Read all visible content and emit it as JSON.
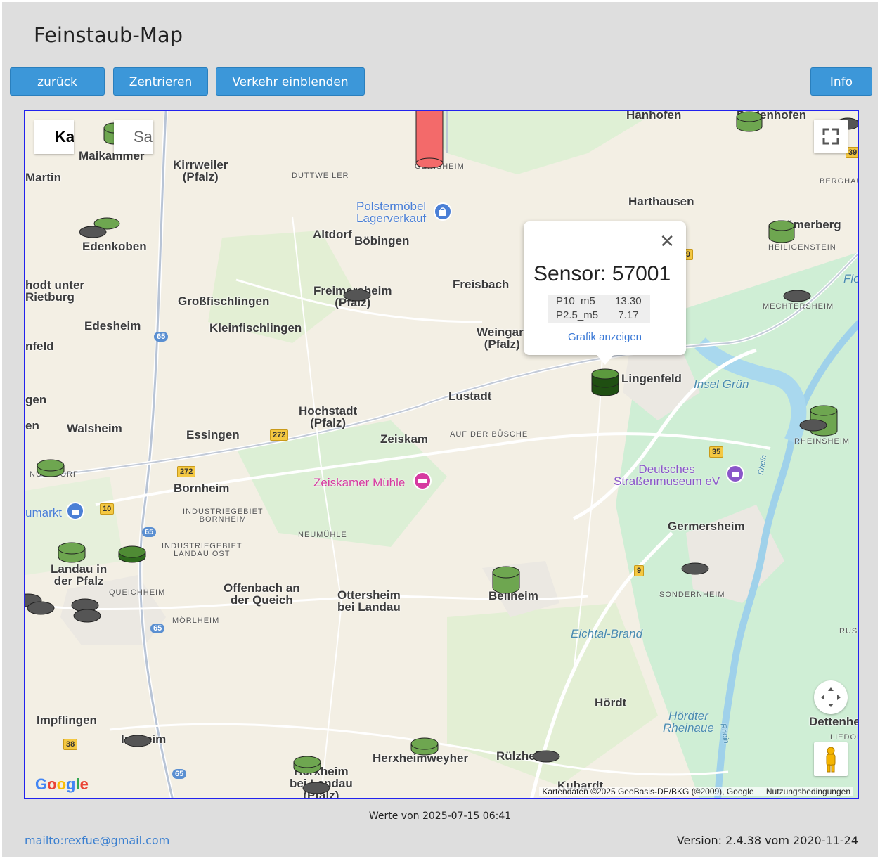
{
  "page": {
    "title": "Feinstaub-Map",
    "buttons": {
      "back": "zurück",
      "center": "Zentrieren",
      "traffic": "Verkehr einblenden",
      "info": "Info"
    },
    "footer": {
      "timestamp": "Werte von 2025-07-15 06:41",
      "mail": "mailto:rexfue@gmail.com",
      "version": "Version: 2.4.38 vom 2020-11-24"
    }
  },
  "map": {
    "map_type": {
      "karte": "Karte",
      "satellit": "Satellit"
    },
    "attribution": "Kartendaten ©2025 GeoBasis-DE/BKG (©2009), Google",
    "terms": "Nutzungsbedingungen",
    "google_logo": "Google",
    "icons": {
      "fullscreen": "fullscreen-icon",
      "camera": "camera-control-icon",
      "pegman": "pegman-icon",
      "close": "close-icon"
    },
    "places": {
      "hanhofen": "Hanhofen",
      "dudenhofen": "Dudenhofen",
      "maikammer": "Maikammer",
      "kirrweiler": "Kirrweiler\n(Pfalz)",
      "martin": "Martin",
      "duttweiler": "DUTTWEILER",
      "geinsheim": "GEINSHEIM",
      "harthausen": "Harthausen",
      "berghausen": "BERGHAUSEN",
      "edenkoben": "Edenkoben",
      "altdorf": "Altdorf",
      "boebingen": "Böbingen",
      "roemerberg": "Römerberg",
      "heiligenstein": "HEILIGENSTEIN",
      "rhodt": "hodt unter\nRietburg",
      "grossfischlingen": "Großfischlingen",
      "freimersheim": "Freimersheim\n(Pfalz)",
      "freisbach": "Freisbach",
      "mechtersheim": "MECHTERSHEIM",
      "edesheim": "Edesheim",
      "kleinfischlingen": "Kleinfischlingen",
      "weingarten": "Weingart\n(Pfalz)",
      "feld": "nfeld",
      "lingenfeld": "Lingenfeld",
      "lustadt": "Lustadt",
      "gen": "gen",
      "hochstadt": "Hochstadt\n(Pfalz)",
      "en": "en",
      "walsheim": "Walsheim",
      "essingen": "Essingen",
      "zeiskam": "Zeiskam",
      "aufderbuesche": "AUF DER BÜSCHE",
      "rheinsheim": "RHEINSHEIM",
      "nussdorf": "NUSSDORF",
      "bornheim": "Bornheim",
      "industrie_bornheim": "INDUSTRIEGEBIET\nBORNHEIM",
      "neumuehle": "NEUMÜHLE",
      "germersheim": "Germersheim",
      "industrie_landau": "INDUSTRIEGEBIET\nLANDAU OST",
      "landau": "Landau in\nder Pfalz",
      "queichheim": "QUEICHHEIM",
      "offenbach": "Offenbach an\nder Queich",
      "ottersheim": "Ottersheim\nbei Landau",
      "bellheim": "Bellheim",
      "sondernheim": "SONDERNHEIM",
      "moerlheim": "MÖRLHEIM",
      "russheim": "RUSSH",
      "hoerdt": "Hördt",
      "impflingen": "Impflingen",
      "dettenheim": "Dettenhe",
      "liedolsheim": "LIEDOLS",
      "insheim": "Insheim",
      "herxheimweyher": "Herxheimweyher",
      "ruelzheim": "Rülzheim",
      "herxheim": "Herxheim\nbei Landau\n(Pfalz)",
      "kuhardt": "Kuhardt"
    },
    "pois": {
      "polster": "Polstermöbel\nLagerverkauf",
      "zeiskamer": "Zeiskamer Mühle",
      "museum": "Deutsches\nStraßenmuseum eV",
      "umarkt": "umarkt"
    },
    "water": {
      "insel": "Insel Grün",
      "flo": "Flo",
      "eichtal": "Eichtal-Brand",
      "hoerdter": "Hördter\nRheinaue",
      "rhein1": "Rhein",
      "rhein2": "Rhein"
    },
    "roads": {
      "r65a": "65",
      "r65b": "65",
      "r65c": "65",
      "r65d": "65",
      "r272a": "272",
      "r272b": "272",
      "r10": "10",
      "r9a": "9",
      "r9b": "9",
      "r35": "35",
      "r38": "38",
      "r39": "39"
    },
    "popup": {
      "title": "Sensor: 57001",
      "rows": [
        {
          "name": "P10_m5",
          "value": "13.30"
        },
        {
          "name": "P2.5_m5",
          "value": "7.17"
        }
      ],
      "link": "Grafik anzeigen"
    },
    "colors": {
      "good": "#5c9a3e",
      "very_good": "#2f6a1c",
      "offline": "#444444",
      "bad": "#ff6666"
    }
  }
}
